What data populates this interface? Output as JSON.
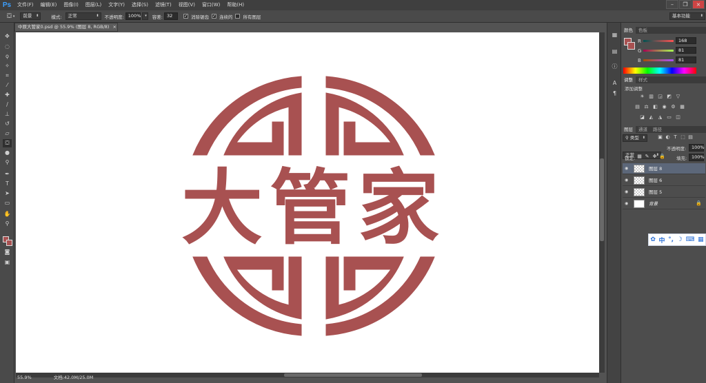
{
  "app": {
    "logo": "Ps"
  },
  "menu": [
    "文件(F)",
    "编辑(E)",
    "图像(I)",
    "图层(L)",
    "文字(Y)",
    "选择(S)",
    "滤镜(T)",
    "视图(V)",
    "窗口(W)",
    "帮助(H)"
  ],
  "options": {
    "tool_preset": "前景",
    "mode_label": "模式:",
    "mode_value": "正常",
    "opacity_label": "不透明度:",
    "opacity_value": "100%",
    "tolerance_label": "容差:",
    "tolerance_value": "32",
    "antialias_label": "消除锯齿",
    "contiguous_label": "连续的",
    "all_layers_label": "所有图层",
    "workspace": "基本功能"
  },
  "document": {
    "tab_title": "中原大管家0.psd @ 55.9% (图层 8, RGB/8)",
    "close_glyph": "×",
    "zoom": "55.9%",
    "doc_info": "文档:42.0M/25.0M",
    "logo_text": "大管家",
    "logo_color": "#a85151"
  },
  "color_panel": {
    "tabs": [
      "颜色",
      "色板"
    ],
    "r_label": "R",
    "r_value": "168",
    "g_label": "G",
    "g_value": "81",
    "b_label": "B",
    "b_value": "81",
    "foreground": "#a85151"
  },
  "adjustments_panel": {
    "tabs": [
      "调整",
      "样式"
    ],
    "title": "添加调整"
  },
  "layers_panel": {
    "tabs": [
      "图层",
      "通道",
      "路径"
    ],
    "kind_filter": "类型",
    "blend_mode": "正常",
    "opacity_label": "不透明度:",
    "opacity_value": "100%",
    "lock_label": "锁定:",
    "fill_label": "填充:",
    "fill_value": "100%",
    "layers": [
      {
        "name": "图层 8",
        "selected": true
      },
      {
        "name": "图层 6",
        "selected": false
      },
      {
        "name": "图层 5",
        "selected": false
      },
      {
        "name": "背景",
        "selected": false
      }
    ]
  },
  "ime": {
    "items": [
      "中",
      "°,",
      "☽",
      "⌨",
      "▦"
    ]
  }
}
